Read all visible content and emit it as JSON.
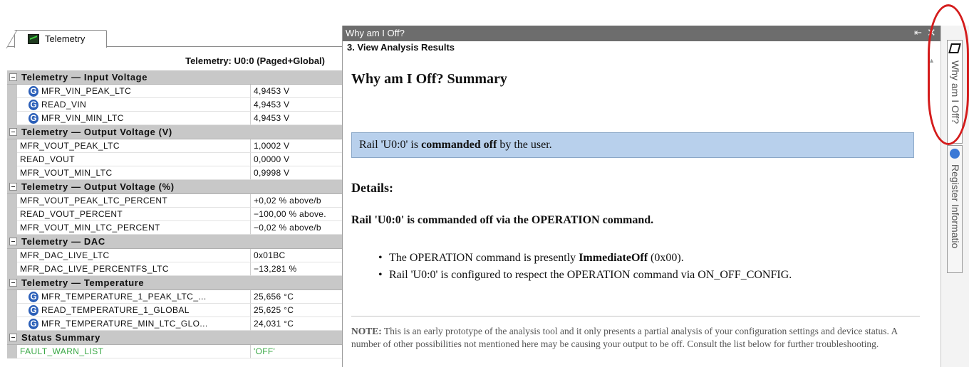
{
  "telemetry_panel": {
    "tab_label": "Telemetry",
    "caption": "Telemetry: U0:0 (Paged+Global)",
    "icon_letter": "G",
    "sections": [
      {
        "title": "Telemetry — Input Voltage",
        "rows": [
          {
            "name": "MFR_VIN_PEAK_LTC",
            "value": "4,9453 V"
          },
          {
            "name": "READ_VIN",
            "value": "4,9453 V"
          },
          {
            "name": "MFR_VIN_MIN_LTC",
            "value": "4,9453 V"
          }
        ]
      },
      {
        "title": "Telemetry — Output Voltage (V)",
        "rows": [
          {
            "name": "MFR_VOUT_PEAK_LTC",
            "value": "1,0002 V"
          },
          {
            "name": "READ_VOUT",
            "value": "0,0000 V"
          },
          {
            "name": "MFR_VOUT_MIN_LTC",
            "value": "0,9998 V"
          }
        ]
      },
      {
        "title": "Telemetry — Output Voltage (%)",
        "rows": [
          {
            "name": "MFR_VOUT_PEAK_LTC_PERCENT",
            "value": "+0,02 % above/b"
          },
          {
            "name": "READ_VOUT_PERCENT",
            "value": "−100,00 % above."
          },
          {
            "name": "MFR_VOUT_MIN_LTC_PERCENT",
            "value": "−0,02 % above/b"
          }
        ]
      },
      {
        "title": "Telemetry — DAC",
        "rows": [
          {
            "name": "MFR_DAC_LIVE_LTC",
            "value": "0x01BC"
          },
          {
            "name": "MFR_DAC_LIVE_PERCENTFS_LTC",
            "value": "−13,281 %"
          }
        ]
      },
      {
        "title": "Telemetry — Temperature",
        "rows": [
          {
            "name": "MFR_TEMPERATURE_1_PEAK_LTC_...",
            "value": "25,656 °C"
          },
          {
            "name": "READ_TEMPERATURE_1_GLOBAL",
            "value": "25,625 °C"
          },
          {
            "name": "MFR_TEMPERATURE_MIN_LTC_GLO...",
            "value": "24,031 °C"
          }
        ]
      },
      {
        "title": "Status Summary",
        "rows": [
          {
            "name": "FAULT_WARN_LIST",
            "value": "'OFF'"
          }
        ]
      }
    ]
  },
  "why_panel": {
    "window_title": "Why am I Off?",
    "pin_glyph": "⇤",
    "close_glyph": "✕",
    "step_label": "3. View Analysis Results",
    "summary_heading": "Why am I Off? Summary",
    "callout": {
      "pre": "Rail 'U0:0' is ",
      "bold": "commanded off",
      "post": " by the user."
    },
    "details_heading": "Details:",
    "rail_heading": "Rail 'U0:0' is commanded off via the OPERATION command.",
    "bullet1": {
      "pre": "The OPERATION command is presently ",
      "bold": "ImmediateOff",
      "post": " (0x00)."
    },
    "bullet2": "Rail 'U0:0' is configured to respect the OPERATION command via ON_OFF_CONFIG.",
    "note": {
      "label": "NOTE:",
      "text": " This is an early prototype of the analysis tool and it only presents a partial analysis of your configuration settings and device status. A number of other possibilities not mentioned here may be causing your output to be off. Consult the list below for further troubleshooting."
    },
    "scroll_arrow": "▲"
  },
  "side_tabs": {
    "tab1": "Why am I Off?",
    "tab2": "Register Informatio"
  },
  "colors": {
    "highlight": "#d41c1c",
    "callout_bg": "#b8d0ec",
    "status_green": "#39a845",
    "title_bar": "#6d6d6d"
  }
}
